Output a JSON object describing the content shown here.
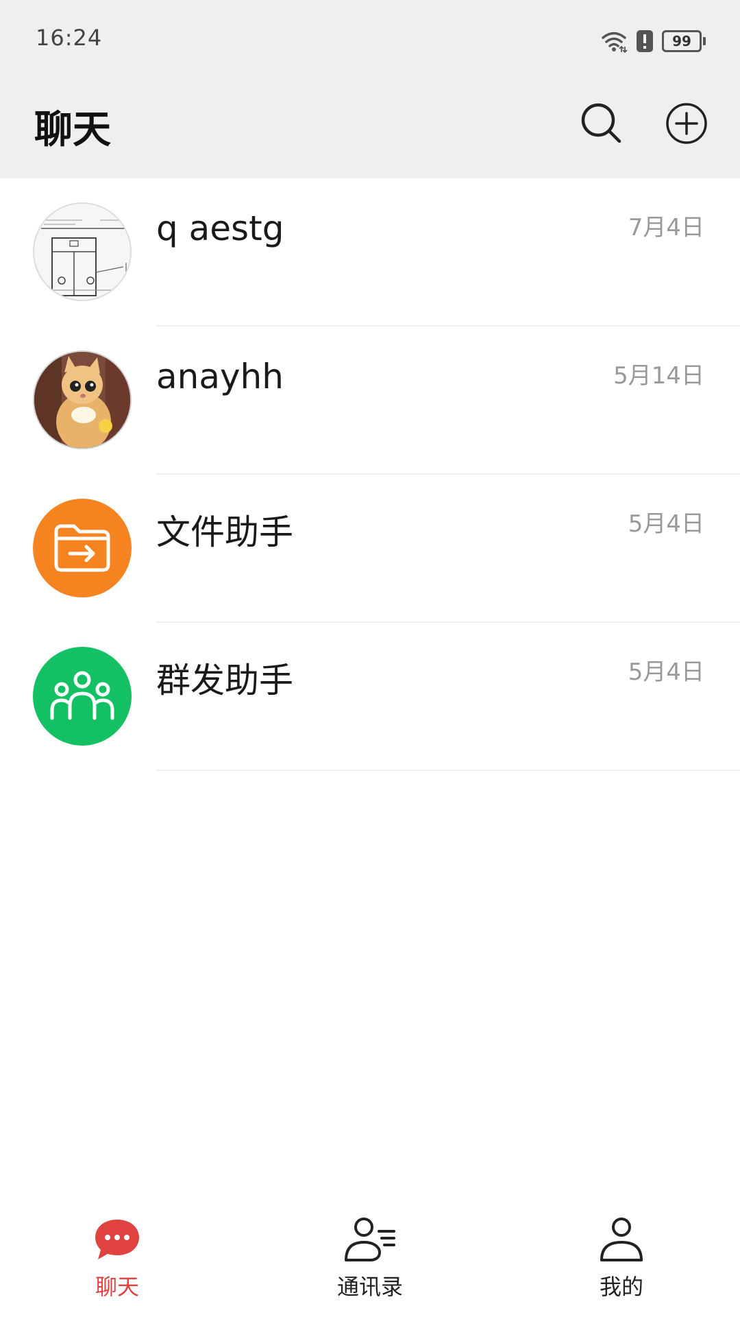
{
  "status_bar": {
    "time": "16:24",
    "battery": "99"
  },
  "header": {
    "title": "聊天"
  },
  "chats": [
    {
      "name": "q aestg",
      "time": "7月4日",
      "avatar": "sketch-photo"
    },
    {
      "name": "anayhh",
      "time": "5月14日",
      "avatar": "cat-photo"
    },
    {
      "name": "文件助手",
      "time": "5月4日",
      "avatar": "folder-arrow-icon"
    },
    {
      "name": "群发助手",
      "time": "5月4日",
      "avatar": "group-icon"
    }
  ],
  "tabs": [
    {
      "label": "聊天",
      "icon": "chat-bubble-icon",
      "active": true
    },
    {
      "label": "通讯录",
      "icon": "contacts-icon",
      "active": false
    },
    {
      "label": "我的",
      "icon": "person-icon",
      "active": false
    }
  ],
  "colors": {
    "accent": "#e0433f",
    "header_bg": "#efefef",
    "files_avatar": "#f5831f",
    "group_avatar": "#13c063",
    "time_text": "#999999"
  }
}
